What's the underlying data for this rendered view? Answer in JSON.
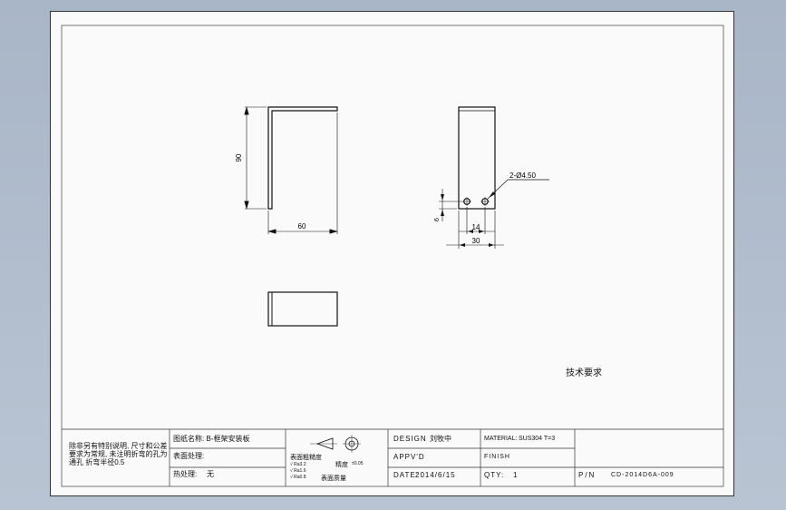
{
  "drawing": {
    "view_front": {
      "dim_height": "90",
      "dim_width": "60"
    },
    "view_side": {
      "hole_callout": "2-Ø4.50",
      "dim_edge": "6",
      "dim_hole_spacing": "14",
      "dim_width": "30"
    }
  },
  "tech_requirements_label": "技术要求",
  "title_block": {
    "notes": "除非另有特别说明, 尺寸和公差要求为常规, 未注明折弯的孔为通孔 折弯半径0.5",
    "drawing_name": "图纸名称: B-框架安装板",
    "surface_treatment": "表面处理:",
    "heat_treatment_label": "热处理:",
    "heat_treatment_value": "无",
    "roughness_label": "表面粗糙度",
    "roughness_values": [
      "√ Ra3.2",
      "√ Ra1.6",
      "√ Ra0.8"
    ],
    "precision_label": "精度",
    "precision_value": "±0.05",
    "surface_quality": "表面质量",
    "design_label": "DESIGN",
    "design_value": "刘牧中",
    "approved_label": "APPV'D",
    "date_label": "DATE:",
    "date_value": "2014/6/15",
    "material_label": "MATERIAL:",
    "material_value": "SUS304 T=3",
    "finish_label": "FINISH",
    "qty_label": "QTY:",
    "qty_value": "1",
    "pn_label": "P/N",
    "pn_value": "CD-2014D6A-009"
  },
  "colors": {
    "line": "#111111",
    "sheet": "#fafafa",
    "background": "#b3bfce"
  }
}
